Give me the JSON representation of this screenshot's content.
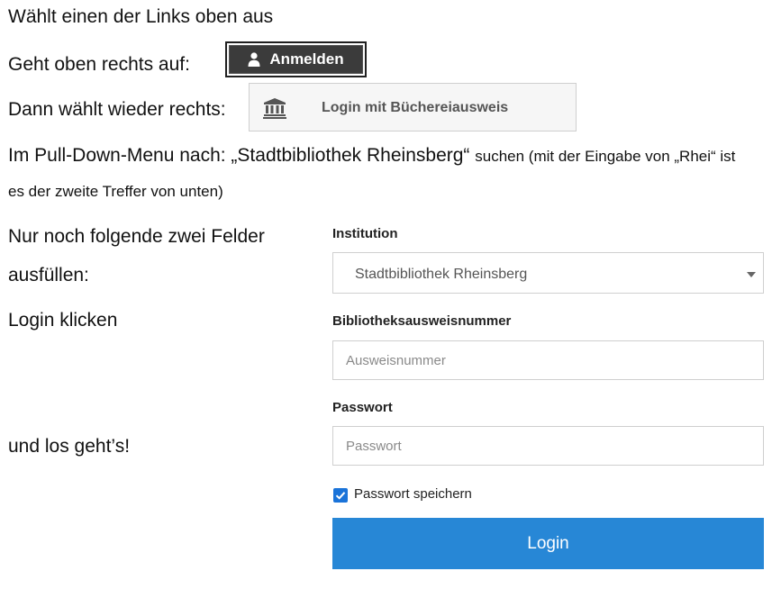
{
  "instructions": {
    "line1": "Wählt einen der Links oben aus",
    "line2": "Geht oben rechts auf:",
    "line3": "Dann wählt wieder rechts:",
    "line4_main": "Im Pull-Down-Menu nach: „Stadtbibliothek Rheinsberg“",
    "line4_small": "suchen (mit der Eingabe von „Rhei“ ist",
    "line5": "es der zweite Treffer von unten)",
    "line6a": "Nur noch folgende zwei Felder",
    "line6b": "ausfüllen:",
    "line7": "Login klicken",
    "line8": "und los geht’s!"
  },
  "header_buttons": {
    "anmelden_label": "Anmelden",
    "anmelden_icon": "user-icon",
    "library_login_label": "Login mit Büchereiausweis",
    "library_login_icon": "bank-icon"
  },
  "form": {
    "institution_label": "Institution",
    "institution_value": "Stadtbibliothek Rheinsberg",
    "card_number_label": "Bibliotheksausweisnummer",
    "card_number_placeholder": "Ausweisnummer",
    "card_number_value": "",
    "password_label": "Passwort",
    "password_placeholder": "Passwort",
    "password_value": "",
    "remember_label": "Passwort speichern",
    "remember_checked": true,
    "login_label": "Login"
  },
  "colors": {
    "login_button": "#2787d6",
    "checkbox": "#1a73d9",
    "anmelden_button": "#3b3b3b"
  }
}
